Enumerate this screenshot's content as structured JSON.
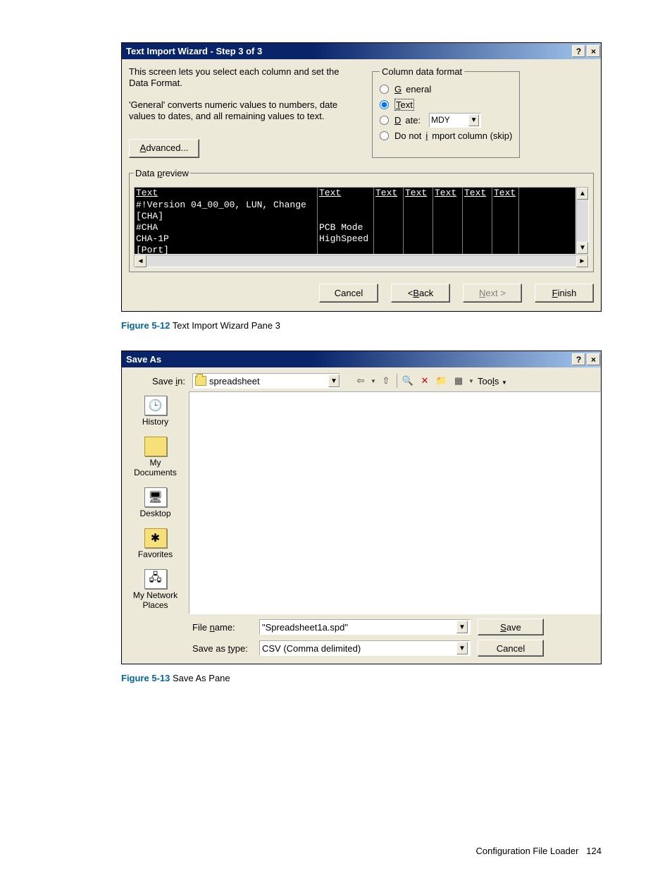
{
  "wizard": {
    "title": "Text Import Wizard - Step 3 of 3",
    "desc1": "This screen lets you select each column and set the Data Format.",
    "desc2": "'General' converts numeric values to numbers, date values to dates, and all remaining values to text.",
    "advanced": "Advanced...",
    "format": {
      "legend": "Column data format",
      "general": "General",
      "text": "Text",
      "date": "Date:",
      "dateFormat": "MDY",
      "skip": "Do not import column (skip)"
    },
    "preview": {
      "legend": "Data preview",
      "headers": [
        "Text",
        "Text",
        "Text",
        "Text",
        "Text",
        "Text",
        "Text"
      ],
      "rows": [
        [
          "#!Version 04_00_00, LUN, Change",
          "",
          "",
          "",
          "",
          "",
          ""
        ],
        [
          "[CHA]",
          "",
          "",
          "",
          "",
          "",
          ""
        ],
        [
          "#CHA",
          "PCB Mode",
          "",
          "",
          "",
          "",
          ""
        ],
        [
          "CHA-1P",
          "HighSpeed",
          "",
          "",
          "",
          "",
          ""
        ],
        [
          "[Port]",
          "",
          "",
          "",
          "",
          "",
          ""
        ]
      ]
    },
    "buttons": {
      "cancel": "Cancel",
      "back": "< Back",
      "next": "Next >",
      "finish": "Finish"
    }
  },
  "caption1": {
    "bold": "Figure 5-12",
    "text": " Text Import Wizard Pane 3"
  },
  "saveas": {
    "title": "Save As",
    "savein_lbl": "Save in:",
    "savein_val": "spreadsheet",
    "tools": "Tools",
    "places": [
      "History",
      "My Documents",
      "Desktop",
      "Favorites",
      "My Network Places"
    ],
    "filename_lbl": "File name:",
    "filename_val": "\"Spreadsheet1a.spd\"",
    "type_lbl": "Save as type:",
    "type_val": "CSV (Comma delimited)",
    "save": "Save",
    "cancel": "Cancel"
  },
  "caption2": {
    "bold": "Figure 5-13",
    "text": " Save As Pane"
  },
  "footer": {
    "label": "Configuration File Loader",
    "page": "124"
  }
}
